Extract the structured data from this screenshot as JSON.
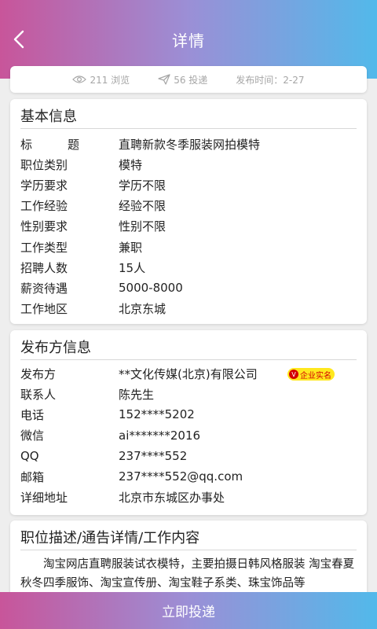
{
  "header": {
    "title": "详情"
  },
  "stats": {
    "views": "211 浏览",
    "shares": "56 投递",
    "publish_time": "发布时间：2-27"
  },
  "basic_info": {
    "title": "基本信息",
    "rows": [
      {
        "label": "标题",
        "value": "直聘新款冬季服装网拍模特"
      },
      {
        "label": "职位类别",
        "value": "模特"
      },
      {
        "label": "学历要求",
        "value": "学历不限"
      },
      {
        "label": "工作经验",
        "value": "经验不限"
      },
      {
        "label": "性别要求",
        "value": "性别不限"
      },
      {
        "label": "工作类型",
        "value": "兼职"
      },
      {
        "label": "招聘人数",
        "value": "15人"
      },
      {
        "label": "薪资待遇",
        "value": "5000-8000"
      },
      {
        "label": "工作地区",
        "value": "北京东城"
      }
    ]
  },
  "publisher_info": {
    "title": "发布方信息",
    "badge": "企业实名",
    "rows": [
      {
        "label": "发布方",
        "value": "**文化传媒(北京)有限公司"
      },
      {
        "label": "联系人",
        "value": "陈先生"
      },
      {
        "label": "电话",
        "value": "152****5202"
      },
      {
        "label": "微信",
        "value": "ai*******2016"
      },
      {
        "label": "QQ",
        "value": "237****552"
      },
      {
        "label": "邮箱",
        "value": "237****552@qq.com"
      },
      {
        "label": "详细地址",
        "value": "北京市东城区办事处"
      }
    ]
  },
  "description": {
    "title": "职位描述/通告详情/工作内容",
    "text": "淘宝网店直聘服装试衣模特，主要拍摄日韩风格服装 淘宝春夏秋冬四季服饰、淘宝宣传册、淘宝鞋子系类、珠宝饰品等"
  },
  "footer": {
    "apply_label": "立即投递"
  }
}
